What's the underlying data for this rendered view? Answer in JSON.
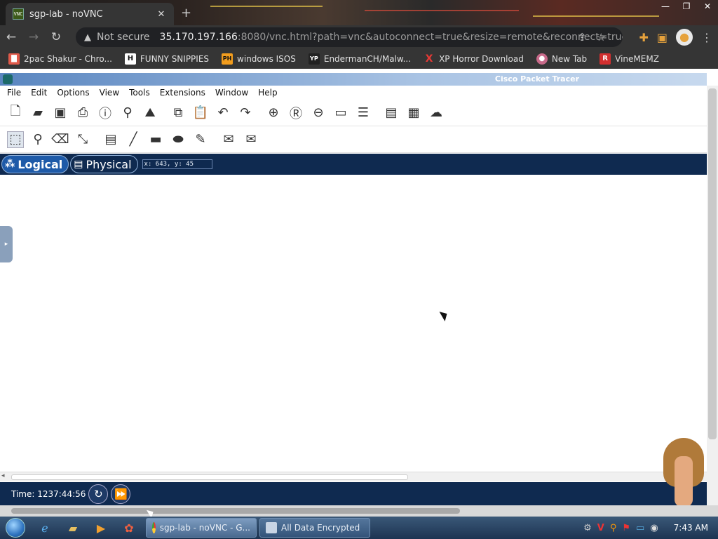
{
  "browser": {
    "tab_title": "sgp-lab - noVNC",
    "tab_favicon_text": "VNC",
    "address_warning": "Not secure",
    "url_host": "35.170.197.166",
    "url_rest": ":8080/vnc.html?path=vnc&autoconnect=true&resize=remote&reconnect=true...",
    "bookmarks": [
      {
        "label": "2pac Shakur - Chro...",
        "icon": "bookmark-red-icon",
        "color": "#e05a4a"
      },
      {
        "label": "FUNNY SNIPPIES",
        "icon": "H",
        "color": "#ffffff"
      },
      {
        "label": "windows ISOS",
        "icon": "PH",
        "color": "#f29d1e"
      },
      {
        "label": "EndermanCH/Malw...",
        "icon": "YP",
        "color": "#222222"
      },
      {
        "label": "XP Horror Download",
        "icon": "X",
        "color": "#e53935"
      },
      {
        "label": "New Tab",
        "icon": "avatar-icon",
        "color": "#c86a8a"
      },
      {
        "label": "VineMEMZ",
        "icon": "R",
        "color": "#d32f2f"
      }
    ]
  },
  "pt": {
    "window_title": "Cisco Packet Tracer",
    "menu": [
      "File",
      "Edit",
      "Options",
      "View",
      "Tools",
      "Extensions",
      "Window",
      "Help"
    ],
    "tabs": [
      "Logical",
      "Physical"
    ],
    "coords": "x: 643, y: 45",
    "time_label": "Time: 1237:44:56"
  },
  "taskbar": {
    "items": [
      "sgp-lab - noVNC - G...",
      "All Data Encrypted"
    ],
    "clock": "7:43 AM"
  }
}
